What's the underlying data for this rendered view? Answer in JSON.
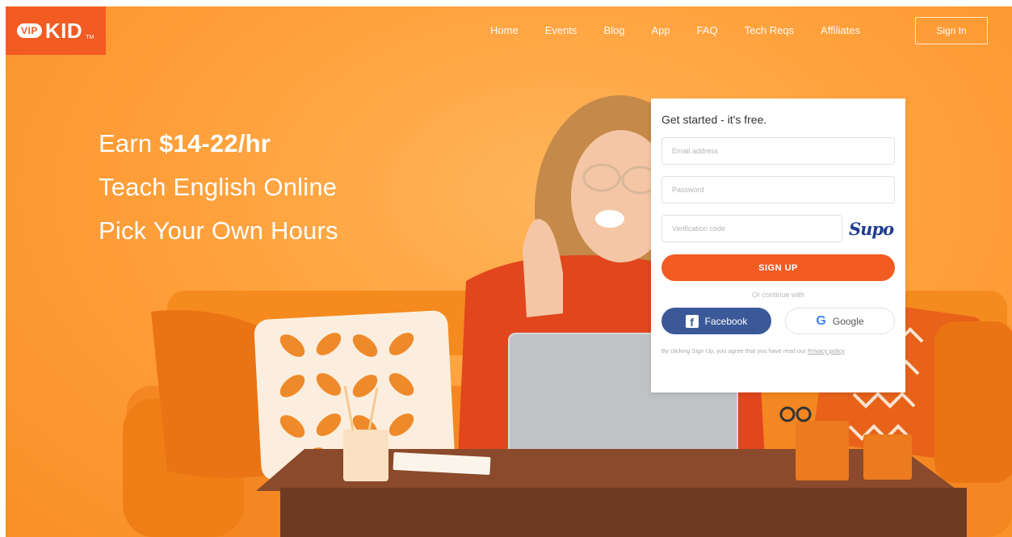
{
  "brand": {
    "vip": "VIP",
    "kid": "KID",
    "tm": "TM"
  },
  "nav": {
    "items": [
      "Home",
      "Events",
      "Blog",
      "App",
      "FAQ",
      "Tech Reqs",
      "Affiliates"
    ],
    "signin": "Sign In"
  },
  "headline": {
    "earn_prefix": "Earn ",
    "earn_amount": "$14-22/hr",
    "line2": "Teach English Online",
    "line3": "Pick Your Own Hours"
  },
  "form": {
    "title": "Get started - it's free.",
    "email_placeholder": "Email address",
    "password_placeholder": "Password",
    "verification_placeholder": "Verification code",
    "captcha_text": "Supo",
    "signup_label": "SIGN UP",
    "continue_text": "Or continue with",
    "facebook_label": "Facebook",
    "google_label": "Google",
    "terms_text": "By clicking Sign Up, you agree that you have read our ",
    "terms_link": "Privacy policy"
  },
  "icons": {
    "facebook": "facebook-icon",
    "google": "google-icon"
  },
  "colors": {
    "brand_orange": "#f25b22",
    "facebook_blue": "#3b5998",
    "background": "#ffa13c"
  }
}
